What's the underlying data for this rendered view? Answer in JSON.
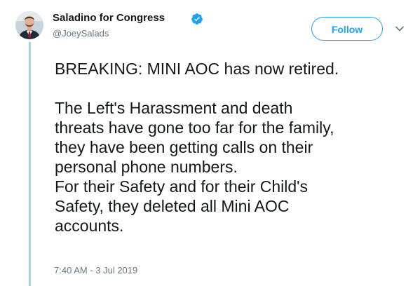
{
  "author": {
    "display_name": "Saladino for Congress",
    "handle": "@JoeySalads",
    "verified": true,
    "avatar_icon": "profile-photo"
  },
  "actions": {
    "follow_label": "Follow",
    "more_icon": "chevron-down-icon"
  },
  "tweet": {
    "text": "BREAKING: MINI AOC has now retired.\n\nThe Left's Harassment and death\nthreats have gone too far for the family,\nthey have been getting calls on their\npersonal phone numbers.\nFor their Safety and for their Child's\nSafety, they deleted all Mini AOC\naccounts.",
    "timestamp": "7:40 AM - 3 Jul 2019"
  },
  "colors": {
    "accent": "#1da1f2",
    "thread_line": "#9fd5e2",
    "text_primary": "#14171a",
    "text_secondary": "#657786"
  }
}
